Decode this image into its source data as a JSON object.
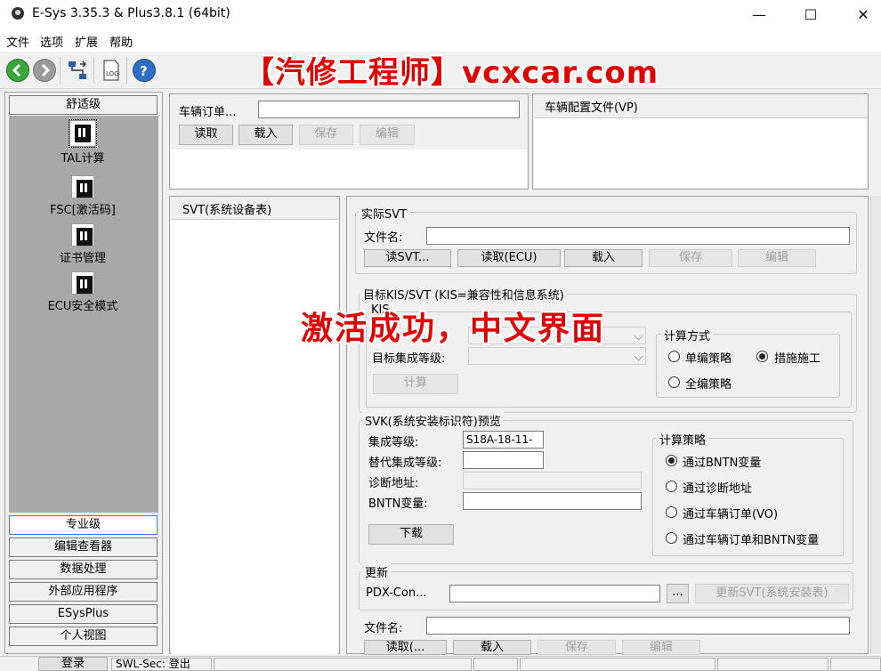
{
  "window": {
    "title": "E-Sys 3.35.3 & Plus3.8.1  (64bit)",
    "minimize": "—",
    "maximize": "☐",
    "close": "✕"
  },
  "menu": [
    "文件",
    "选项",
    "扩展",
    "帮助"
  ],
  "watermark": "【汽修工程师】vcxcar.com",
  "overlay_message": "激活成功，中文界面",
  "left": {
    "top_category": "舒适级",
    "tools": [
      "TAL计算",
      "FSC[激活码]",
      "证书管理",
      "ECU安全模式"
    ],
    "categories": [
      "专业级",
      "编辑查看器",
      "数据处理",
      "外部应用程序",
      "ESysPlus",
      "个人视图"
    ]
  },
  "vehicle_order": {
    "label": "车辆订单...",
    "value": "",
    "buttons": [
      "读取",
      "载入",
      "保存",
      "编辑"
    ]
  },
  "vp": {
    "title": "车辆配置文件(VP)"
  },
  "svt_pane": {
    "title": "SVT(系统设备表)"
  },
  "actual_svt": {
    "title": "实际SVT",
    "file_label": "文件名:",
    "file_value": "",
    "buttons": [
      "读SVT...",
      "读取(ECU)",
      "载入",
      "保存",
      "编辑"
    ]
  },
  "target": {
    "title": "目标KIS/SVT (KIS=兼容性和信息系统)",
    "kis_title": "KIS",
    "target_level_label": "目标集成等级:",
    "calc_button": "计算",
    "calc_mode_title": "计算方式",
    "calc_mode_options": [
      "单编策略",
      "措施施工",
      "全编策略"
    ],
    "calc_mode_selected": "措施施工"
  },
  "svk": {
    "title": "SVK(系统安装标识符)预览",
    "integration_label": "集成等级:",
    "integration_value": "S18A-18-11-",
    "alt_integration_label": "替代集成等级:",
    "alt_integration_value": "",
    "diag_label": "诊断地址:",
    "diag_value": "",
    "bntn_label": "BNTN变量:",
    "bntn_value": "",
    "download_button": "下载",
    "strategy_title": "计算策略",
    "strategy_options": [
      "通过BNTN变量",
      "通过诊断地址",
      "通过车辆订单(VO)",
      "通过车辆订单和BNTN变量"
    ],
    "strategy_selected": "通过BNTN变量"
  },
  "update": {
    "title": "更新",
    "pdx_label": "PDX-Con...",
    "pdx_value": "",
    "browse_button": "...",
    "update_svt_button": "更新SVT(系统安装表)",
    "file_label": "文件名:",
    "file_value": "",
    "buttons": [
      "读取(...",
      "载入",
      "保存",
      "编辑"
    ]
  },
  "status": {
    "login_button": "登录",
    "swl_sec": "SWL-Sec: 登出"
  }
}
